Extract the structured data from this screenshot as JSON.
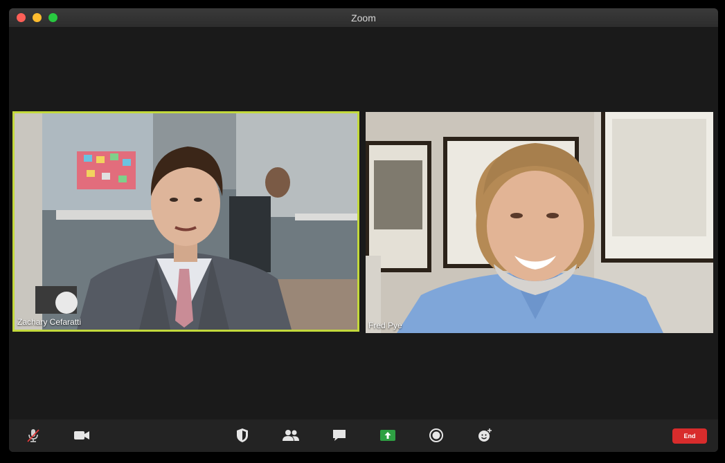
{
  "window": {
    "title": "Zoom"
  },
  "participants": [
    {
      "name": "Zachary Cefaratti",
      "active_speaker": true
    },
    {
      "name": "Fred Pye",
      "active_speaker": false
    }
  ],
  "toolbar": {
    "buttons": [
      {
        "icon": "microphone-muted-icon"
      },
      {
        "icon": "video-camera-icon"
      },
      {
        "icon": "shield-icon"
      },
      {
        "icon": "participants-icon"
      },
      {
        "icon": "chat-icon"
      },
      {
        "icon": "share-screen-icon"
      },
      {
        "icon": "record-icon"
      },
      {
        "icon": "reactions-icon"
      }
    ],
    "end_label": "End"
  },
  "colors": {
    "active_speaker_border": "#c3d93c",
    "share_button": "#2ea043",
    "end_button": "#d82c2c"
  }
}
